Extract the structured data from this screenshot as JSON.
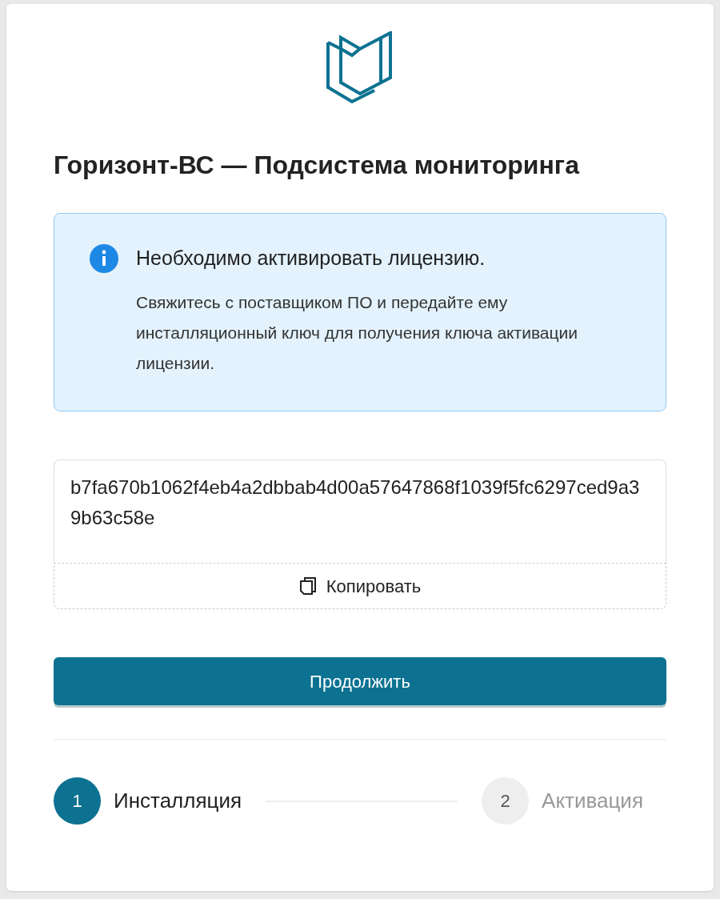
{
  "title": "Горизонт-ВС — Подсистема мониторинга",
  "alert": {
    "heading": "Необходимо активировать лицензию.",
    "text": "Свяжитесь с поставщиком ПО и передайте ему инсталляционный ключ для получения ключа активации лицензии."
  },
  "key_field": {
    "value": "b7fa670b1062f4eb4a2dbbab4d00a57647868f1039f5fc6297ced9a39b63c58e"
  },
  "copy_button": "Копировать",
  "continue_button": "Продолжить",
  "steps": [
    {
      "number": "1",
      "label": "Инсталляция",
      "selected": true
    },
    {
      "number": "2",
      "label": "Активация",
      "selected": false
    }
  ]
}
